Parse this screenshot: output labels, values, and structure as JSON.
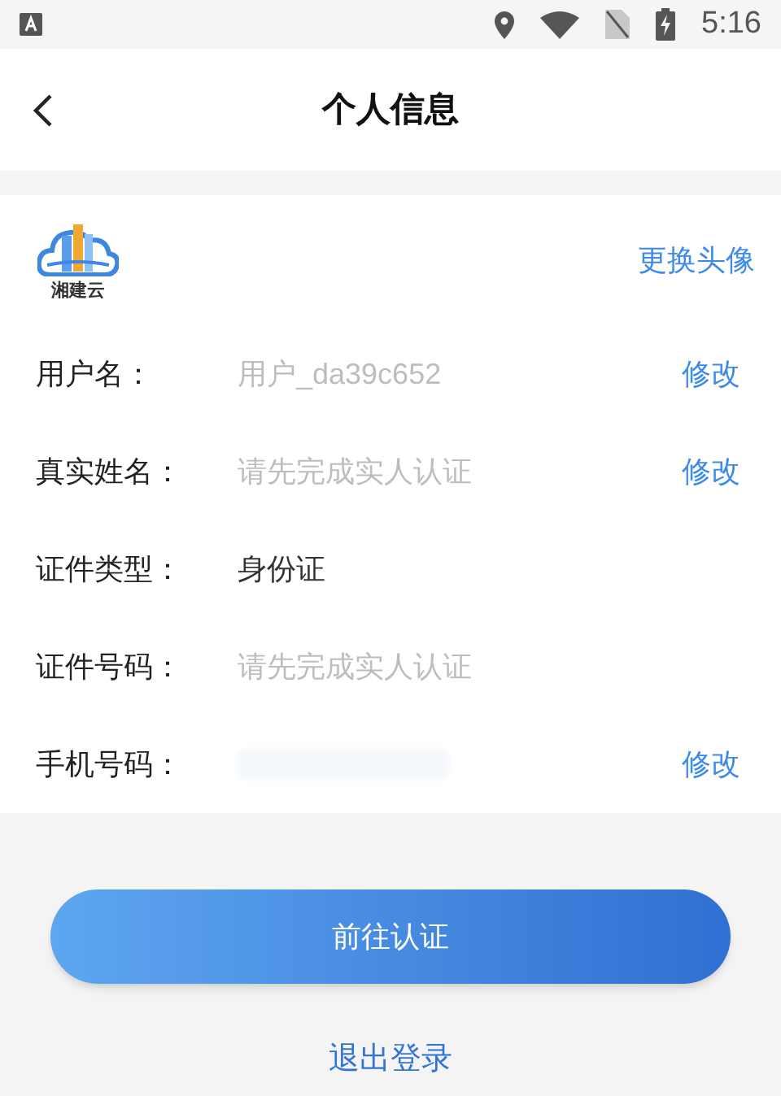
{
  "status_bar": {
    "time": "5:16"
  },
  "header": {
    "title": "个人信息"
  },
  "avatar": {
    "logo_text": "湘建云",
    "action": "更换头像"
  },
  "fields": [
    {
      "label": "用户名：",
      "kind": "hint",
      "value": "用户_da39c652",
      "action": "修改"
    },
    {
      "label": "真实姓名：",
      "kind": "hint",
      "value": "请先完成实人认证",
      "action": "修改"
    },
    {
      "label": "证件类型：",
      "kind": "filled",
      "value": "身份证"
    },
    {
      "label": "证件号码：",
      "kind": "hint",
      "value": "请先完成实人认证"
    },
    {
      "label": "手机号码：",
      "kind": "redacted",
      "action": "修改"
    }
  ],
  "primary_button": "前往认证",
  "logout_link": "退出登录"
}
